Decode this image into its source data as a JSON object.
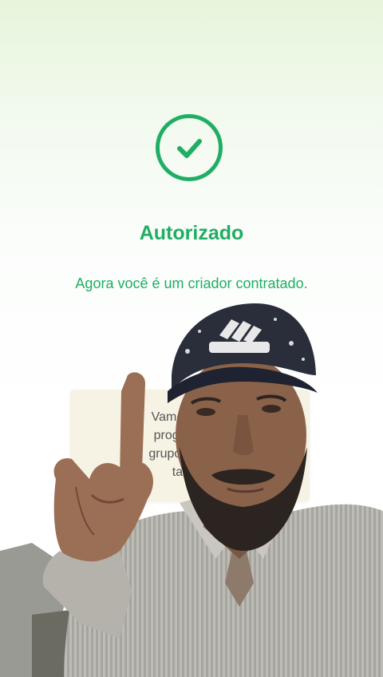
{
  "status": {
    "title": "Autorizado",
    "message": "Agora você é um criador contratado."
  },
  "info_card": {
    "line1": "Vamos enviar",
    "line2": "programa de",
    "line3": "grupo oficial, c",
    "line4": "tambe"
  },
  "colors": {
    "accent": "#1fae64",
    "background_top": "#e7f5dc",
    "card_background": "#f7f3e4"
  },
  "icons": {
    "status_icon": "check-circle-icon"
  },
  "overlay": {
    "type": "person-webcam-overlay",
    "cap_logo": "adidas"
  }
}
